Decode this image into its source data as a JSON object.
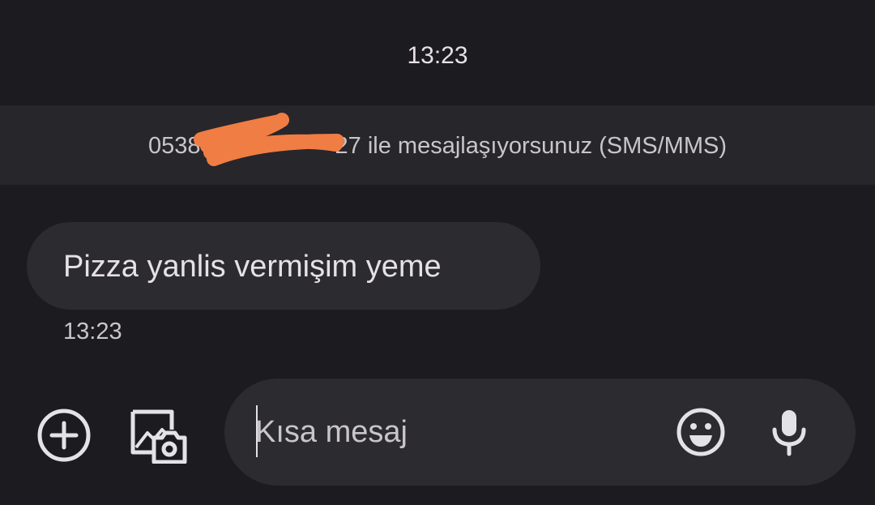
{
  "conversation": {
    "date_header": "13:23",
    "info_banner": {
      "phone_visible_start": "0538",
      "phone_visible_end": "27",
      "text": " ile mesajlaşıyorsunuz (SMS/MMS)"
    }
  },
  "messages": [
    {
      "text": "Pizza yanlis vermişim yeme",
      "time": "13:23"
    }
  ],
  "composer": {
    "placeholder": "Kısa mesaj",
    "value": ""
  },
  "icons": {
    "add": "plus-circle-icon",
    "gallery": "gallery-camera-icon",
    "emoji": "emoji-icon",
    "mic": "microphone-icon"
  },
  "colors": {
    "background": "#1c1b1f",
    "surface": "#2c2b30",
    "banner": "#27262b",
    "redaction": "#f07d43",
    "icon": "#e3e2e6"
  }
}
